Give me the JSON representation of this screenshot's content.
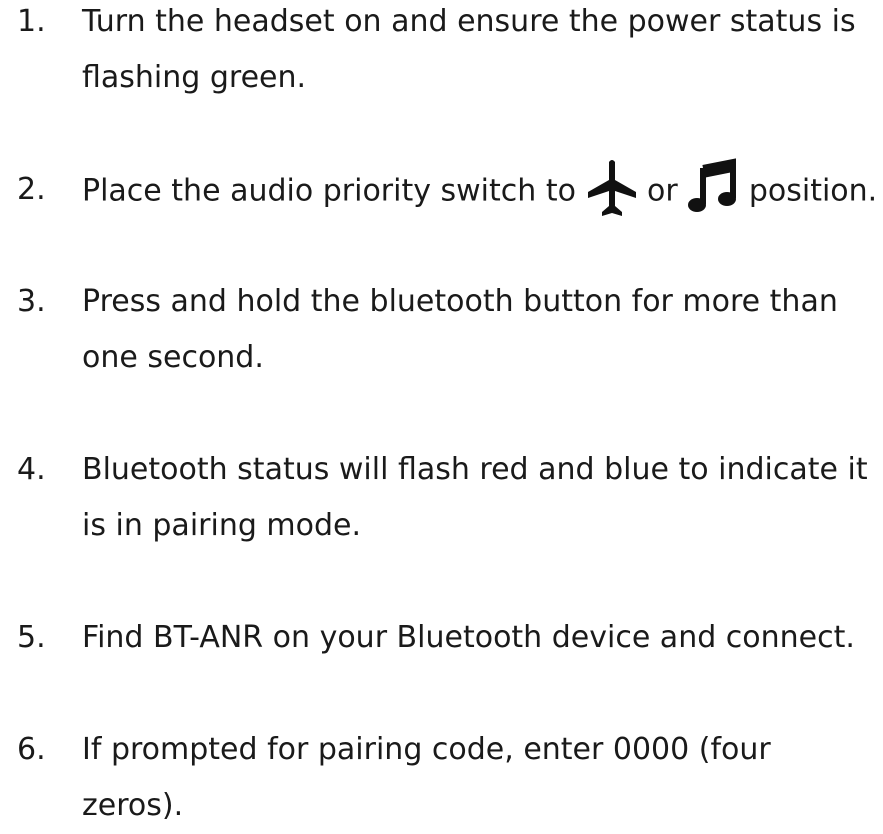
{
  "steps": [
    {
      "number": "1.",
      "lines": [
        "Turn the headset on and ensure the power status is",
        "flashing green."
      ]
    },
    {
      "number": "2.",
      "before": "Place the audio priority switch to",
      "icon1": "airplane-icon",
      "middle": "or",
      "icon2": "music-note-icon",
      "after": "position."
    },
    {
      "number": "3.",
      "lines": [
        "Press and hold the bluetooth button for more than",
        "one second."
      ]
    },
    {
      "number": "4.",
      "lines": [
        "Bluetooth status will flash red and blue to indicate it",
        "is in pairing mode."
      ]
    },
    {
      "number": "5.",
      "lines": [
        "Find BT-ANR on your Bluetooth device and connect."
      ]
    },
    {
      "number": "6.",
      "lines": [
        "If prompted for pairing code, enter 0000 (four",
        "zeros)."
      ]
    }
  ],
  "colors": {
    "text": "#1a1a1a",
    "background": "#ffffff"
  }
}
